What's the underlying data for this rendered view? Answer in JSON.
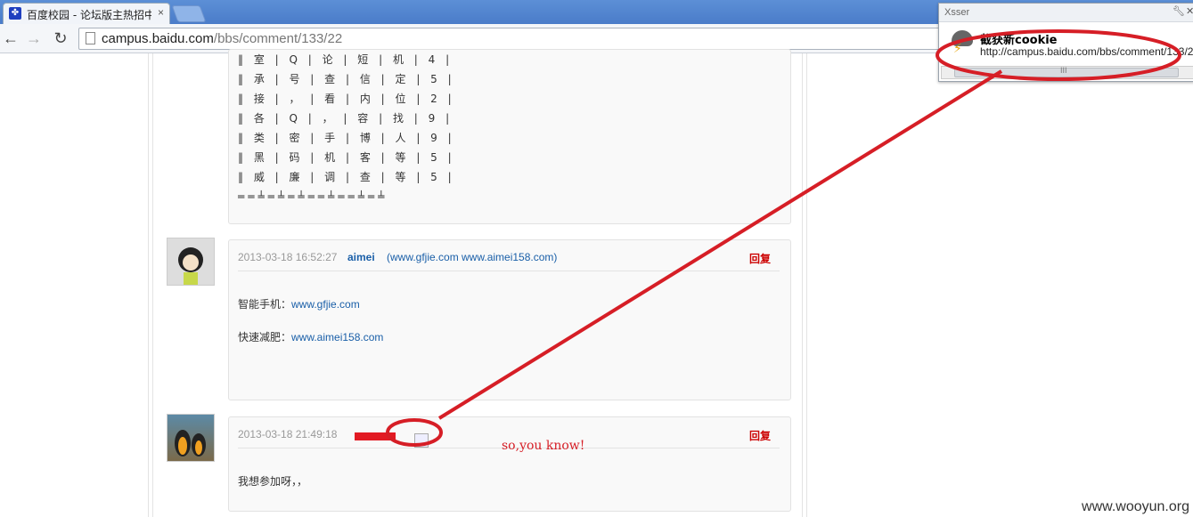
{
  "browser": {
    "tab_title": "百度校园 - 论坛版主热招中",
    "tab_close": "×",
    "url_host": "campus.baidu.com",
    "url_path": "/bbs/comment/133/22",
    "back_icon": "←",
    "forward_icon": "→",
    "reload_icon": "↻"
  },
  "post1": {
    "lines": [
      "‖ 室 | Q | 论 | 短 | 机 | 4 |",
      "‖ 承 | 号 | 查 | 信 | 定 | 5 |",
      "‖ 接 | ， | 看 | 内 | 位 | 2 |",
      "‖ 各 | Q | ， | 容 | 找 | 9 |",
      "‖ 类 | 密 | 手 | 博 | 人 | 9 |",
      "‖ 黑 | 码 | 机 | 客 | 等 | 5 |",
      "‖ 威 | 廉 | 调 | 查 | 等 | 5 |",
      "══╧═╧═╧══╧══╧═╧"
    ]
  },
  "post2": {
    "time": "2013-03-18 16:52:27",
    "author": "aimei",
    "site": "(www.gfjie.com www.aimei158.com)",
    "reply": "回复",
    "line1_label": "智能手机：",
    "line1_link": "www.gfjie.com",
    "line2_label": "快速减肥：",
    "line2_link": "www.aimei158.com"
  },
  "post3": {
    "time": "2013-03-18 21:49:18",
    "reply": "回复",
    "body": "我想参加呀，，"
  },
  "annotation": "so,you know!",
  "watermark": "www.wooyun.org",
  "popup": {
    "title": "Xsser",
    "notice_title": "截获新cookie",
    "notice_url": "http://campus.baidu.com/bbs/comment/133/22",
    "scroll_mark": "III"
  },
  "colors": {
    "annotation": "#d61e26",
    "link": "#1a5fa8",
    "reply": "#cc0000"
  }
}
